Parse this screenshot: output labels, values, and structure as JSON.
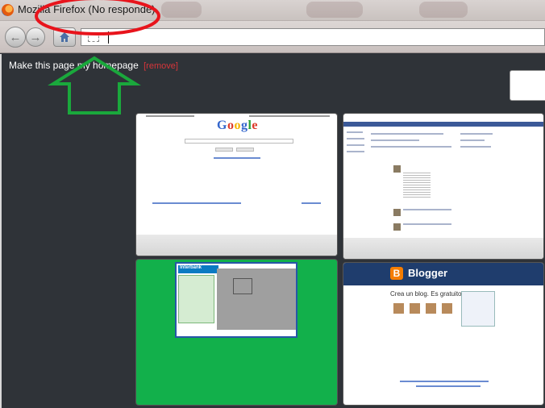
{
  "window": {
    "title": "Mozilla Firefox (No responde)"
  },
  "navbar": {
    "url_value": ""
  },
  "content": {
    "homepage_text": "Make this page my homepage",
    "remove_label": "[remove]"
  },
  "tiles": {
    "google_logo": "Google",
    "interbank_logo": "Interbank",
    "blogger_title": "Blogger",
    "blogger_subtitle": "Crea un blog. Es gratuito."
  },
  "colors": {
    "annotation_ellipse": "#e8141c",
    "annotation_arrow": "#1aa83c",
    "interbank_green": "#12b04b",
    "blogger_header": "#1f3d6d"
  },
  "icons": [
    "firefox-icon",
    "back-arrow-icon",
    "forward-arrow-icon",
    "home-icon",
    "page-favicon-icon"
  ]
}
